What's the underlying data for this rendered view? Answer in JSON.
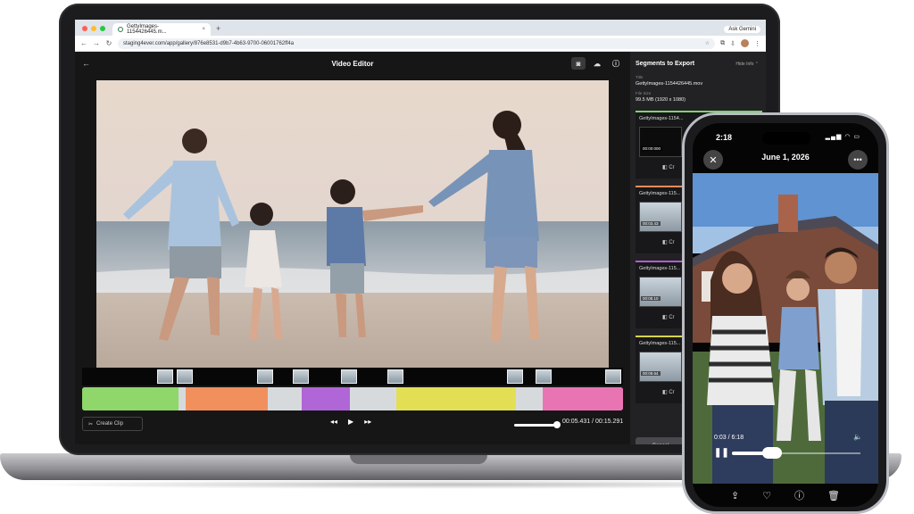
{
  "browser": {
    "tab_title": "GettyImages-1154426445.m...",
    "tab_close": "×",
    "new_tab": "+",
    "ask_gemini": "Ask Gemini",
    "url": "staging4ever.com/app/gallery/876e8531-d9b7-4b63-9700-06001762ff4a"
  },
  "editor": {
    "title": "Video Editor",
    "back": "←",
    "create_clip": "Create Clip",
    "rewind": "◂◂",
    "play": "▶",
    "forward": "▸▸",
    "time": "00:05.431 / 00:15.291",
    "volume_level": 0.9
  },
  "sidebar": {
    "title": "Segments to Export",
    "more": "Hide Info ⌃",
    "title_label": "Title",
    "title_value": "GettyImages-1154426445.mov",
    "size_label": "File Size",
    "size_value": "99.5 MB (1920 x 1080)",
    "segments": [
      {
        "name": "GettyImages-1154...",
        "time": "00:00:000",
        "color": "#7ed36b"
      },
      {
        "name": "GettyImages-115...",
        "time": "00:03.43",
        "color": "#f28b5b"
      },
      {
        "name": "GettyImages-115...",
        "time": "00:08.10",
        "color": "#b05ed6"
      },
      {
        "name": "GettyImages-115...",
        "time": "00:09.64",
        "color": "#d7d34e"
      }
    ],
    "cancel": "Cancel"
  },
  "phone": {
    "clock": "2:18",
    "status": "▂▄▆ ◠ ▭",
    "date": "June 1, 2026",
    "elapsed": "0:03",
    "duration": "6:18",
    "progress": 0.3
  },
  "colors": {
    "green": "#8fd66b",
    "orange": "#f1905d",
    "purple": "#b066d6",
    "yellow": "#e3df55",
    "pink": "#e974b3"
  }
}
